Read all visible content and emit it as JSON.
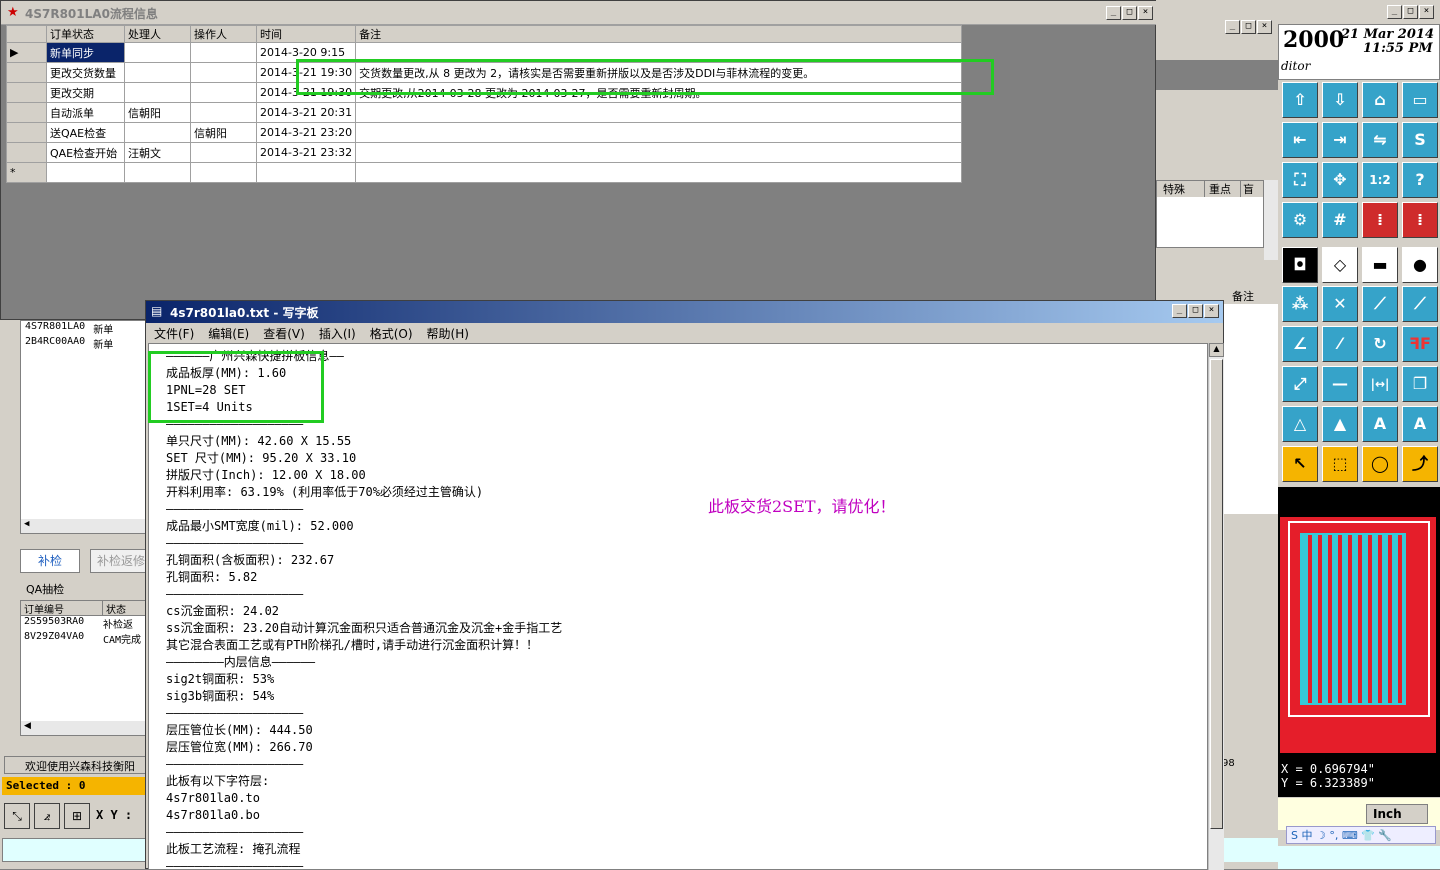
{
  "flow_window": {
    "title": "4S7R801LA0流程信息",
    "columns": [
      "订单状态",
      "处理人",
      "操作人",
      "时间",
      "备注"
    ],
    "rows": [
      {
        "status": "新单同步",
        "handler": "",
        "operator": "",
        "time": "2014-3-20 9:15",
        "note": ""
      },
      {
        "status": "更改交货数量",
        "handler": "",
        "operator": "",
        "time": "2014-3-21 19:30",
        "note": "交货数量更改,从        8 更改为          2，请核实是否需要重新拼版以及是否涉及DDI与菲林流程的变更。"
      },
      {
        "status": "更改交期",
        "handler": "",
        "operator": "",
        "time": "2014-3-21 19:30",
        "note": "交期更改,从2014-03-28 更改为 2014-03-27，是否需要重新封周期。"
      },
      {
        "status": "自动派单",
        "handler": "信朝阳",
        "operator": "",
        "time": "2014-3-21 20:31",
        "note": ""
      },
      {
        "status": "送QAE检查",
        "handler": "",
        "operator": "信朝阳",
        "time": "2014-3-21 23:20",
        "note": ""
      },
      {
        "status": "QAE检查开始",
        "handler": "汪朝文",
        "operator": "",
        "time": "2014-3-21 23:32",
        "note": ""
      }
    ],
    "new_row_marker": "*"
  },
  "left_panel": {
    "list_rows": [
      [
        "4S7R801LA0",
        "新单"
      ],
      [
        "2B4RC00AA0",
        "新单"
      ]
    ],
    "buttons": {
      "recheck": "补检",
      "recheck_return": "补检返修"
    },
    "qa_title": "QA抽检",
    "qa_columns": [
      "订单编号",
      "状态"
    ],
    "qa_rows": [
      [
        "2S59503RA0",
        "补检返"
      ],
      [
        "8V29Z04VA0",
        "CAM完成"
      ]
    ],
    "welcome": "欢迎使用兴森科技衡阳",
    "selected": "Selected : 0",
    "xy_label": "X Y :"
  },
  "wordpad": {
    "title": "4s7r801la0.txt - 写字板",
    "menu": [
      "文件(F)",
      "编辑(E)",
      "查看(V)",
      "插入(I)",
      "格式(O)",
      "帮助(H)"
    ],
    "lines": [
      "——————广州兴森快捷拼板信息——",
      "成品板厚(MM): 1.60",
      "1PNL=28 SET",
      "1SET=4 Units",
      "———————————————————",
      "单只尺寸(MM): 42.60 X 15.55",
      "SET 尺寸(MM): 95.20 X 33.10",
      "拼版尺寸(Inch): 12.00 X 18.00",
      "开料利用率: 63.19% (利用率低于70%必须经过主管确认)",
      "———————————————————",
      "成品最小SMT宽度(mil): 52.000",
      "———————————————————",
      "孔铜面积(含板面积): 232.67",
      "孔铜面积: 5.82",
      "———————————————————",
      "cs沉金面积: 24.02",
      "ss沉金面积: 23.20自动计算沉金面积只适合普通沉金及沉金+金手指工艺",
      "其它混合表面工艺或有PTH阶梯孔/槽时,请手动进行沉金面积计算！！",
      "————————内层信息——————",
      "sig2t铜面积: 53%",
      "sig3b铜面积: 54%",
      "———————————————————",
      "层压管位长(MM): 444.50",
      "层压管位宽(MM): 266.70",
      "———————————————————",
      "此板有以下字符层:",
      "4s7r801la0.to",
      "4s7r801la0.bo",
      "———————————————————",
      "此板工艺流程: 掩孔流程",
      "———————————————————"
    ],
    "annotation": "此板交货2SET，请优化！"
  },
  "middle_panel": {
    "columns": [
      "特殊",
      "重点",
      "盲"
    ],
    "columns2": [
      "备注"
    ],
    "footer": "98"
  },
  "right_panel": {
    "year": "2000",
    "date": "21 Mar 2014",
    "time": "11:55 PM",
    "editor": "ditor",
    "coord_x": "X =  0.696794\"",
    "coord_y": "Y =  6.323389\"",
    "unit": "Inch",
    "ime": "S 中 ☽ °, ⌨ 👕 🔧"
  },
  "colors": {
    "highlight_box": "#22cc22",
    "annotation": "#c000c0",
    "tool_cyan": "#36a3c9",
    "tool_yellow": "#f5b400"
  }
}
